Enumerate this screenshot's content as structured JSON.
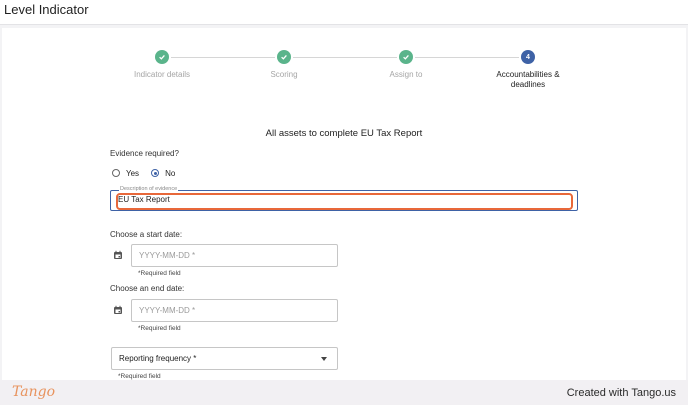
{
  "header": {
    "title": "Level Indicator"
  },
  "stepper": {
    "steps": [
      {
        "label": "Indicator details",
        "status": "done"
      },
      {
        "label": "Scoring",
        "status": "done"
      },
      {
        "label": "Assign to",
        "status": "done"
      },
      {
        "label": "Accountabilities &",
        "label2": "deadlines",
        "number": "4",
        "status": "active"
      }
    ]
  },
  "form": {
    "section_title": "All assets to complete EU Tax Report",
    "evidence_question": "Evidence required?",
    "radio_yes": "Yes",
    "radio_no": "No",
    "selected_radio": "No",
    "evidence_floating_label": "Description of evidence",
    "evidence_value": "EU Tax Report",
    "start_date_label": "Choose a start date:",
    "start_date_placeholder": "YYYY-MM-DD *",
    "start_required": "*Required field",
    "end_date_label": "Choose an end date:",
    "end_date_placeholder": "YYYY-MM-DD *",
    "end_required": "*Required field",
    "frequency_label": "Reporting frequency *",
    "frequency_required": "*Required field"
  },
  "footer": {
    "logo": "Tango",
    "credit": "Created with Tango.us"
  },
  "colors": {
    "done_step": "#5ab48b",
    "active_step": "#3e62a6",
    "highlight": "#e8683a"
  }
}
